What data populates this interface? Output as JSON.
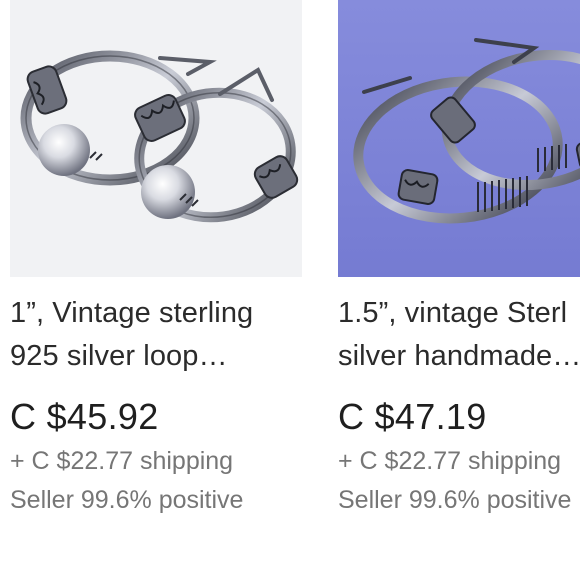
{
  "listings": [
    {
      "image_icon": "earring-photo-icon",
      "image_background": "#f1f2f4",
      "title_line1": "1”, Vintage sterling",
      "title_line2": "925 silver loop…",
      "price": "C $45.92",
      "shipping": "+ C $22.77 shipping",
      "seller": "Seller 99.6% positive"
    },
    {
      "image_icon": "earring-photo-icon",
      "image_background": "#7f86d8",
      "title_line1": "1.5”, vintage Sterl",
      "title_line2": "silver handmade…",
      "price": "C $47.19",
      "shipping": "+ C $22.77 shipping",
      "seller": "Seller 99.6% positive"
    }
  ]
}
